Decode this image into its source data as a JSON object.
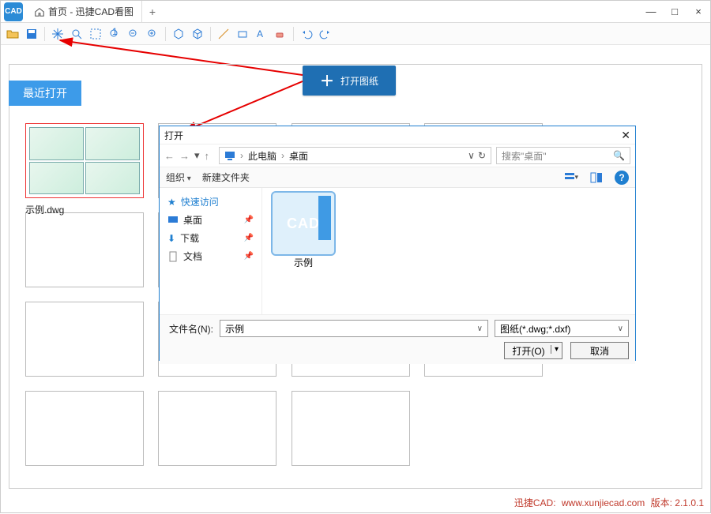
{
  "window": {
    "tab_title": "首页 - 迅捷CAD看图",
    "add_tab": "+",
    "min": "—",
    "max": "□",
    "close": "×"
  },
  "toolbar_icons": [
    "open",
    "save",
    "|",
    "pan",
    "zoom-region",
    "select",
    "zoom-fit",
    "zoom-out",
    "zoom-in",
    "|",
    "box3d",
    "box3d-wire",
    "|",
    "measure-line",
    "measure-rect",
    "annotate",
    "eraser",
    "|",
    "undo",
    "redo"
  ],
  "big_open_btn": "打开图纸",
  "recent_title": "最近打开",
  "first_thumb_caption": "示例.dwg",
  "thumb_count_after_first": 11,
  "dialog": {
    "title": "打开",
    "close": "✕",
    "nav_back": "←",
    "nav_fwd": "→",
    "nav_up_glyph": "↑",
    "path_seg1": "此电脑",
    "path_seg2": "桌面",
    "path_refresh": "↻",
    "search_placeholder": "搜索\"桌面\"",
    "organize": "组织",
    "new_folder": "新建文件夹",
    "nav_items": [
      {
        "icon": "star",
        "label": "快速访问",
        "quick": true
      },
      {
        "icon": "desktop",
        "label": "桌面",
        "pin": true
      },
      {
        "icon": "download",
        "label": "下载",
        "pin": true
      },
      {
        "icon": "doc",
        "label": "文档",
        "pin": true
      }
    ],
    "file_tile_label": "示例",
    "filename_label": "文件名(N):",
    "filename_value": "示例",
    "filter_value": "图纸(*.dwg;*.dxf)",
    "open_btn": "打开(O)",
    "cancel_btn": "取消"
  },
  "footer": {
    "brand": "迅捷CAD:",
    "url": "www.xunjiecad.com",
    "ver_label": "版本:",
    "ver": "2.1.0.1"
  },
  "arrows_note": "two red arrows from big blue button: one to toolbar open icon, one to dialog title"
}
